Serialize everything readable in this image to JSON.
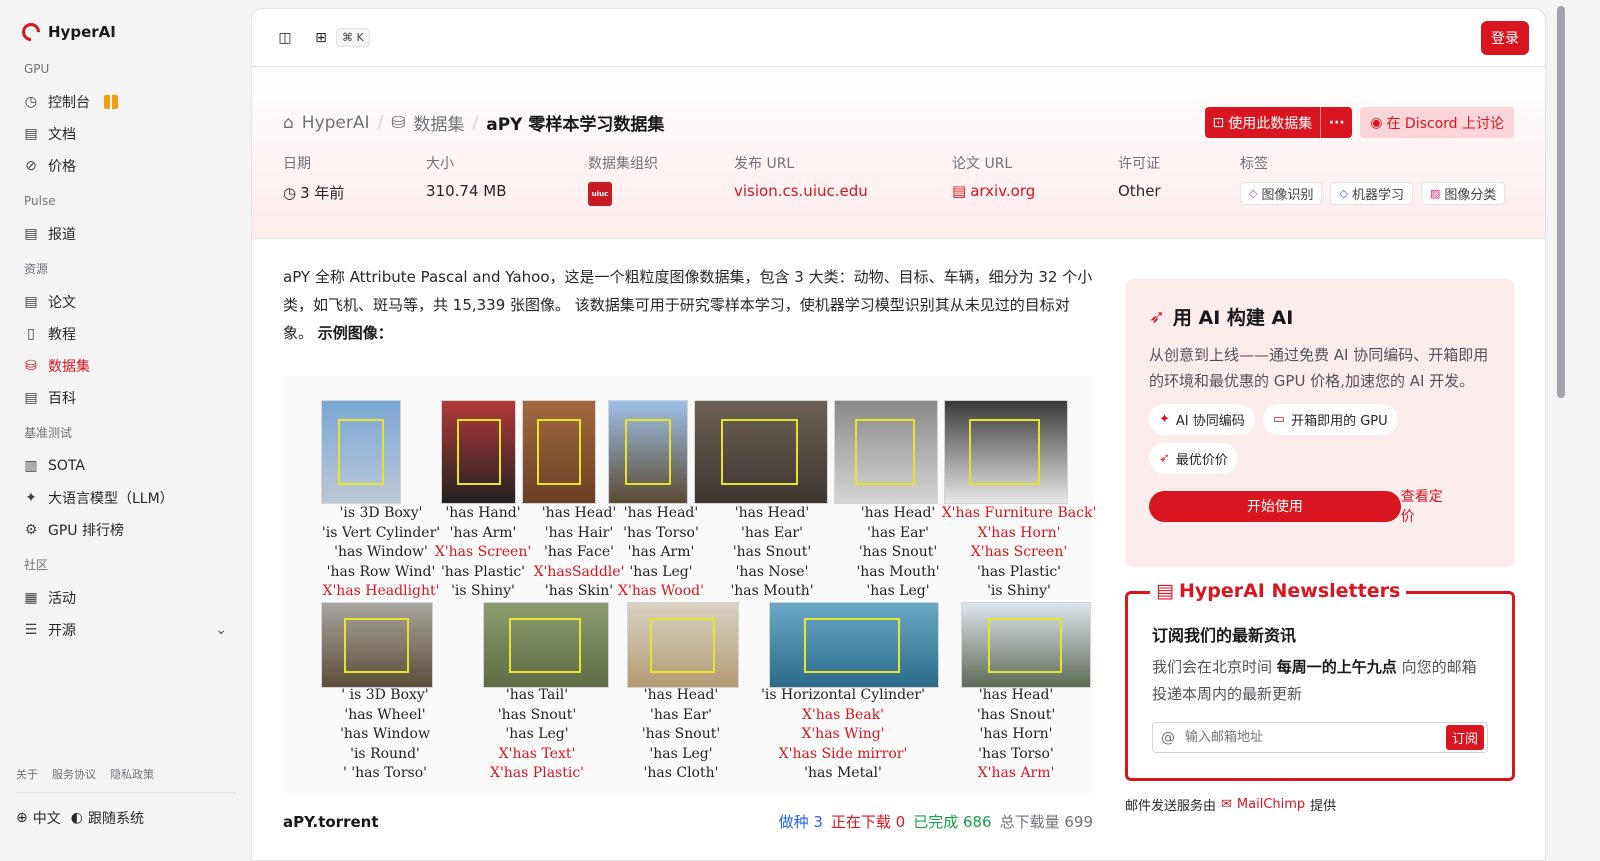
{
  "brand": {
    "name": "HyperAI"
  },
  "sidebar": {
    "sections": [
      {
        "label": "GPU",
        "items": [
          {
            "label": "控制台",
            "icon": "dashboard-icon"
          },
          {
            "label": "文档",
            "icon": "doc-icon"
          },
          {
            "label": "价格",
            "icon": "price-icon"
          }
        ]
      },
      {
        "label": "Pulse",
        "items": [
          {
            "label": "报道",
            "icon": "news-icon"
          }
        ]
      },
      {
        "label": "资源",
        "items": [
          {
            "label": "论文",
            "icon": "paper-icon"
          },
          {
            "label": "教程",
            "icon": "book-icon"
          },
          {
            "label": "数据集",
            "icon": "database-icon"
          },
          {
            "label": "百科",
            "icon": "wiki-icon"
          }
        ]
      },
      {
        "label": "基准测试",
        "items": [
          {
            "label": "SOTA",
            "icon": "chart-icon"
          },
          {
            "label": "大语言模型（LLM）",
            "icon": "sparkle-icon"
          },
          {
            "label": "GPU 排行榜",
            "icon": "gpu-icon"
          }
        ]
      },
      {
        "label": "社区",
        "items": [
          {
            "label": "活动",
            "icon": "calendar-icon"
          },
          {
            "label": "开源",
            "icon": "menu-icon"
          }
        ]
      }
    ],
    "footer_links": [
      "关于",
      "服务协议",
      "隐私政策"
    ],
    "language": "中文",
    "theme": "跟随系统"
  },
  "topbar": {
    "kbd": "⌘ K",
    "login": "登录"
  },
  "breadcrumb": {
    "home": "HyperAI",
    "section": "数据集",
    "current": "aPY 零样本学习数据集"
  },
  "actions": {
    "use_dataset": "使用此数据集",
    "more": "···",
    "discord": "在 Discord 上讨论"
  },
  "meta": {
    "date_label": "日期",
    "date_value": "3 年前",
    "size_label": "大小",
    "size_value": "310.74 MB",
    "org_label": "数据集组织",
    "org_logo_text": "uiuc",
    "release_label": "发布 URL",
    "release_value": "vision.cs.uiuc.edu",
    "paper_label": "论文 URL",
    "paper_value": "arxiv.org",
    "license_label": "许可证",
    "license_value": "Other",
    "tags_label": "标签",
    "tags": [
      "图像识别",
      "机器学习",
      "图像分类"
    ]
  },
  "description": {
    "text": "aPY 全称 Attribute Pascal and Yahoo，这是一个粗粒度图像数据集，包含 3 大类：动物、目标、车辆，细分为 32 个小类，如飞机、斑马等，共 15,339 张图像。 该数据集可用于研究零样本学习，使机器学习模型识别其从未见过的目标对象。 ",
    "example_label": "示例图像："
  },
  "figure": {
    "row1": [
      [
        "'is 3D Boxy'",
        "'is Vert Cylinder'",
        "'has Window'",
        "'has Row Wind'",
        "X'has Headlight'"
      ],
      [
        "'has Hand'",
        "'has Arm'",
        "X'has Screen'",
        "'has Plastic'",
        "'is Shiny'"
      ],
      [
        "'has Head'",
        "'has Hair'",
        "'has Face'",
        "X'hasSaddle'",
        "'has Skin'"
      ],
      [
        "'has Head'",
        "'has Torso'",
        "'has Arm'",
        "'has Leg'",
        "X'has Wood'"
      ],
      [
        "'has Head'",
        "'has Ear'",
        "'has Snout'",
        "'has Nose'",
        "'has Mouth'"
      ],
      [
        "'has Head'",
        "'has Ear'",
        "'has Snout'",
        "'has Mouth'",
        "'has Leg'"
      ],
      [
        "X'has Furniture Back'",
        "X'has Horn'",
        "X'has Screen'",
        "'has Plastic'",
        "'is Shiny'"
      ]
    ],
    "row2": [
      [
        "' is 3D Boxy'",
        "'has Wheel'",
        "'has Window",
        "'is Round'",
        "' 'has Torso'"
      ],
      [
        "'has Tail'",
        "'has Snout'",
        "'has Leg'",
        "X'has Text'",
        "X'has Plastic'"
      ],
      [
        "'has Head'",
        "'has Ear'",
        "'has Snout'",
        "'has Leg'",
        "'has Cloth'"
      ],
      [
        "'is Horizontal Cylinder'",
        "X'has Beak'",
        "X'has Wing'",
        "X'has Side mirror'",
        "'has Metal'"
      ],
      [
        "'has Head'",
        "'has Snout'",
        "'has Horn'",
        "'has Torso'",
        "X'has Arm'"
      ]
    ]
  },
  "torrent": {
    "name": "aPY.torrent",
    "seeding": "做种 3",
    "downloading": "正在下载 0",
    "completed": "已完成 686",
    "total": "总下载量 699",
    "seeding_color": "#2563eb",
    "downloading_color": "#d9161f",
    "completed_color": "#16a34a",
    "total_color": "#71717a"
  },
  "promo": {
    "title": "用 AI 构建 AI",
    "text": "从创意到上线——通过免费 AI 协同编码、开箱即用的环境和最优惠的 GPU 价格,加速您的 AI 开发。",
    "chips": [
      "AI 协同编码",
      "开箱即用的 GPU",
      "最优价价"
    ],
    "start": "开始使用",
    "pricing": "查看定价"
  },
  "newsletter": {
    "title": "HyperAI Newsletters",
    "heading": "订阅我们的最新资讯",
    "text_before": "我们会在北京时间 ",
    "text_bold": "每周一的上午九点",
    "text_after": " 向您的邮箱投递本周内的最新更新",
    "placeholder": "输入邮箱地址",
    "subscribe": "订阅",
    "service_before": "邮件发送服务由",
    "service_name": "MailChimp",
    "service_after": "提供"
  },
  "colors": {
    "accent": "#d9161f",
    "tint": "#fdecec"
  }
}
